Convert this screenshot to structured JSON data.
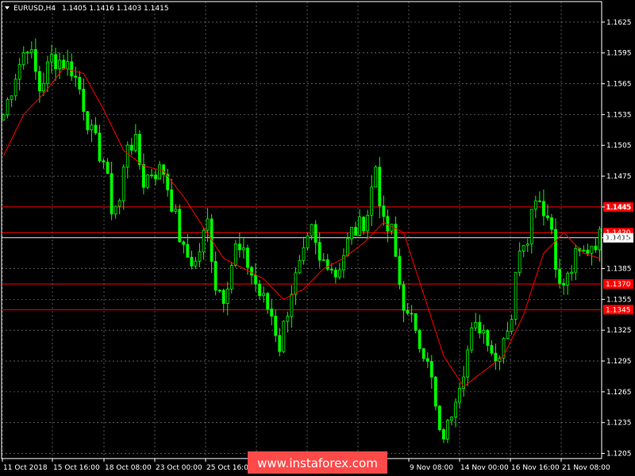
{
  "header": {
    "symbol": "EURUSD,H4",
    "ohlc": "1.1405 1.1416 1.1403 1.1415"
  },
  "watermark": "www.instaforex.com",
  "colors": {
    "background": "#000000",
    "grid": "#ffffff",
    "candle_up": "#00ff00",
    "candle_down": "#00ff00",
    "moving_average": "#ff0000",
    "level_line": "#ff0000",
    "level_label_bg": "#ff0000",
    "current_price_line": "#ffffff",
    "current_price_label_bg": "#ffffff",
    "watermark_bg": "#ff4a4a"
  },
  "chart_data": {
    "type": "candlestick",
    "timeframe": "H4",
    "ylim": [
      1.12,
      1.1645
    ],
    "y_ticks": [
      "1.1625",
      "1.1595",
      "1.1565",
      "1.1535",
      "1.1505",
      "1.1475",
      "1.1445",
      "1.1415",
      "1.1385",
      "1.1355",
      "1.1325",
      "1.1295",
      "1.1265",
      "1.1235",
      "1.1205"
    ],
    "x_tick_labels": [
      "11 Oct 2018",
      "15 Oct 16:00",
      "18 Oct 08:00",
      "23 Oct 00:00",
      "25 Oct 16:00",
      "",
      "",
      "9 Nov 08:00",
      "14 Nov 00:00",
      "16 Nov 16:00",
      "21 Nov 08:00"
    ],
    "grid": true,
    "levels": [
      {
        "price": 1.1445,
        "label": "1.1445"
      },
      {
        "price": 1.142,
        "label": "1.1420"
      },
      {
        "price": 1.137,
        "label": "1.1370"
      },
      {
        "price": 1.1345,
        "label": "1.1345"
      }
    ],
    "current_price": {
      "price": 1.1415,
      "label": "1.1415"
    },
    "close_path": [
      [
        0,
        1.1535
      ],
      [
        3,
        1.1575
      ],
      [
        6,
        1.1605
      ],
      [
        9,
        1.156
      ],
      [
        12,
        1.159
      ],
      [
        14,
        1.1588
      ],
      [
        17,
        1.158
      ],
      [
        19,
        1.156
      ],
      [
        22,
        1.1515
      ],
      [
        25,
        1.149
      ],
      [
        27,
        1.1445
      ],
      [
        29,
        1.145
      ],
      [
        31,
        1.151
      ],
      [
        33,
        1.1505
      ],
      [
        35,
        1.147
      ],
      [
        37,
        1.148
      ],
      [
        40,
        1.148
      ],
      [
        42,
        1.145
      ],
      [
        45,
        1.14
      ],
      [
        48,
        1.139
      ],
      [
        51,
        1.143
      ],
      [
        53,
        1.137
      ],
      [
        55,
        1.136
      ],
      [
        58,
        1.1405
      ],
      [
        61,
        1.139
      ],
      [
        64,
        1.136
      ],
      [
        67,
        1.134
      ],
      [
        69,
        1.131
      ],
      [
        72,
        1.1365
      ],
      [
        75,
        1.1395
      ],
      [
        77,
        1.142
      ],
      [
        79,
        1.139
      ],
      [
        81,
        1.1395
      ],
      [
        83,
        1.138
      ],
      [
        85,
        1.14
      ],
      [
        87,
        1.142
      ],
      [
        89,
        1.1425
      ],
      [
        91,
        1.144
      ],
      [
        93,
        1.1485
      ],
      [
        95,
        1.1425
      ],
      [
        97,
        1.142
      ],
      [
        99,
        1.137
      ],
      [
        101,
        1.1335
      ],
      [
        103,
        1.133
      ],
      [
        105,
        1.1305
      ],
      [
        107,
        1.1275
      ],
      [
        109,
        1.122
      ],
      [
        111,
        1.123
      ],
      [
        113,
        1.1265
      ],
      [
        115,
        1.129
      ],
      [
        117,
        1.132
      ],
      [
        119,
        1.133
      ],
      [
        121,
        1.132
      ],
      [
        123,
        1.1295
      ],
      [
        125,
        1.132
      ],
      [
        127,
        1.134
      ],
      [
        129,
        1.141
      ],
      [
        131,
        1.142
      ],
      [
        133,
        1.146
      ],
      [
        135,
        1.1445
      ],
      [
        137,
        1.1425
      ],
      [
        139,
        1.1365
      ],
      [
        141,
        1.1375
      ],
      [
        143,
        1.1395
      ],
      [
        145,
        1.14
      ],
      [
        147,
        1.141
      ],
      [
        149,
        1.1415
      ]
    ],
    "ma_path": [
      [
        0,
        1.1495
      ],
      [
        5,
        1.1535
      ],
      [
        10,
        1.1555
      ],
      [
        15,
        1.158
      ],
      [
        20,
        1.1575
      ],
      [
        25,
        1.154
      ],
      [
        30,
        1.15
      ],
      [
        35,
        1.1485
      ],
      [
        40,
        1.148
      ],
      [
        45,
        1.1455
      ],
      [
        50,
        1.1425
      ],
      [
        55,
        1.1395
      ],
      [
        60,
        1.1385
      ],
      [
        65,
        1.1375
      ],
      [
        70,
        1.1355
      ],
      [
        75,
        1.1365
      ],
      [
        80,
        1.1385
      ],
      [
        85,
        1.1395
      ],
      [
        90,
        1.141
      ],
      [
        95,
        1.143
      ],
      [
        100,
        1.142
      ],
      [
        105,
        1.136
      ],
      [
        110,
        1.13
      ],
      [
        115,
        1.127
      ],
      [
        120,
        1.1285
      ],
      [
        125,
        1.13
      ],
      [
        130,
        1.134
      ],
      [
        135,
        1.14
      ],
      [
        140,
        1.142
      ],
      [
        145,
        1.14
      ],
      [
        149,
        1.1395
      ]
    ]
  }
}
